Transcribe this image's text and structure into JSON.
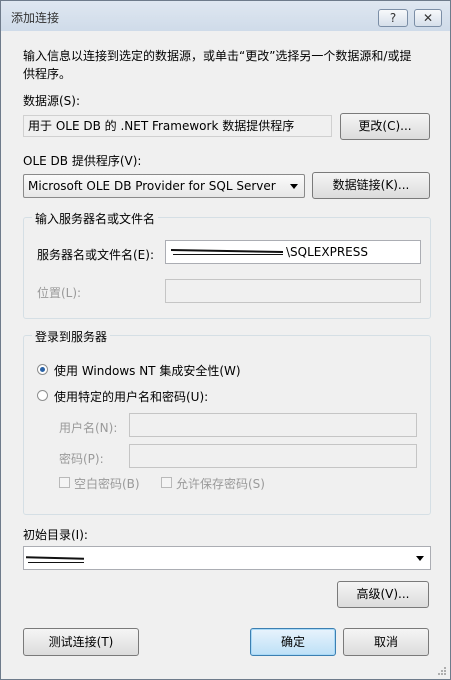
{
  "window": {
    "title": "添加连接",
    "help_btn": "?",
    "close_btn": "✕"
  },
  "intro": {
    "line1": "输入信息以连接到选定的数据源，或单击“更改”选择另一个数据源和/或提",
    "line2": "供程序。"
  },
  "datasource": {
    "label": "数据源(S):",
    "value": "用于 OLE DB 的 .NET Framework 数据提供程序",
    "change_btn": "更改(C)..."
  },
  "provider": {
    "label": "OLE DB 提供程序(V):",
    "value": "Microsoft OLE DB Provider for SQL Server",
    "datalink_btn": "数据链接(K)..."
  },
  "server_group": {
    "title": "输入服务器名或文件名",
    "server_label": "服务器名或文件名(E):",
    "server_value": "\\SQLEXPRESS",
    "location_label": "位置(L):",
    "location_value": ""
  },
  "login_group": {
    "title": "登录到服务器",
    "windows_auth": "使用 Windows NT 集成安全性(W)",
    "specific_user": "使用特定的用户名和密码(U):",
    "username_label": "用户名(N):",
    "username_value": "",
    "password_label": "密码(P):",
    "password_value": "",
    "blank_password": "空白密码(B)",
    "allow_save": "允许保存密码(S)"
  },
  "catalog": {
    "label": "初始目录(I):",
    "value": ""
  },
  "buttons": {
    "advanced": "高级(V)...",
    "test": "测试连接(T)",
    "ok": "确定",
    "cancel": "取消"
  }
}
